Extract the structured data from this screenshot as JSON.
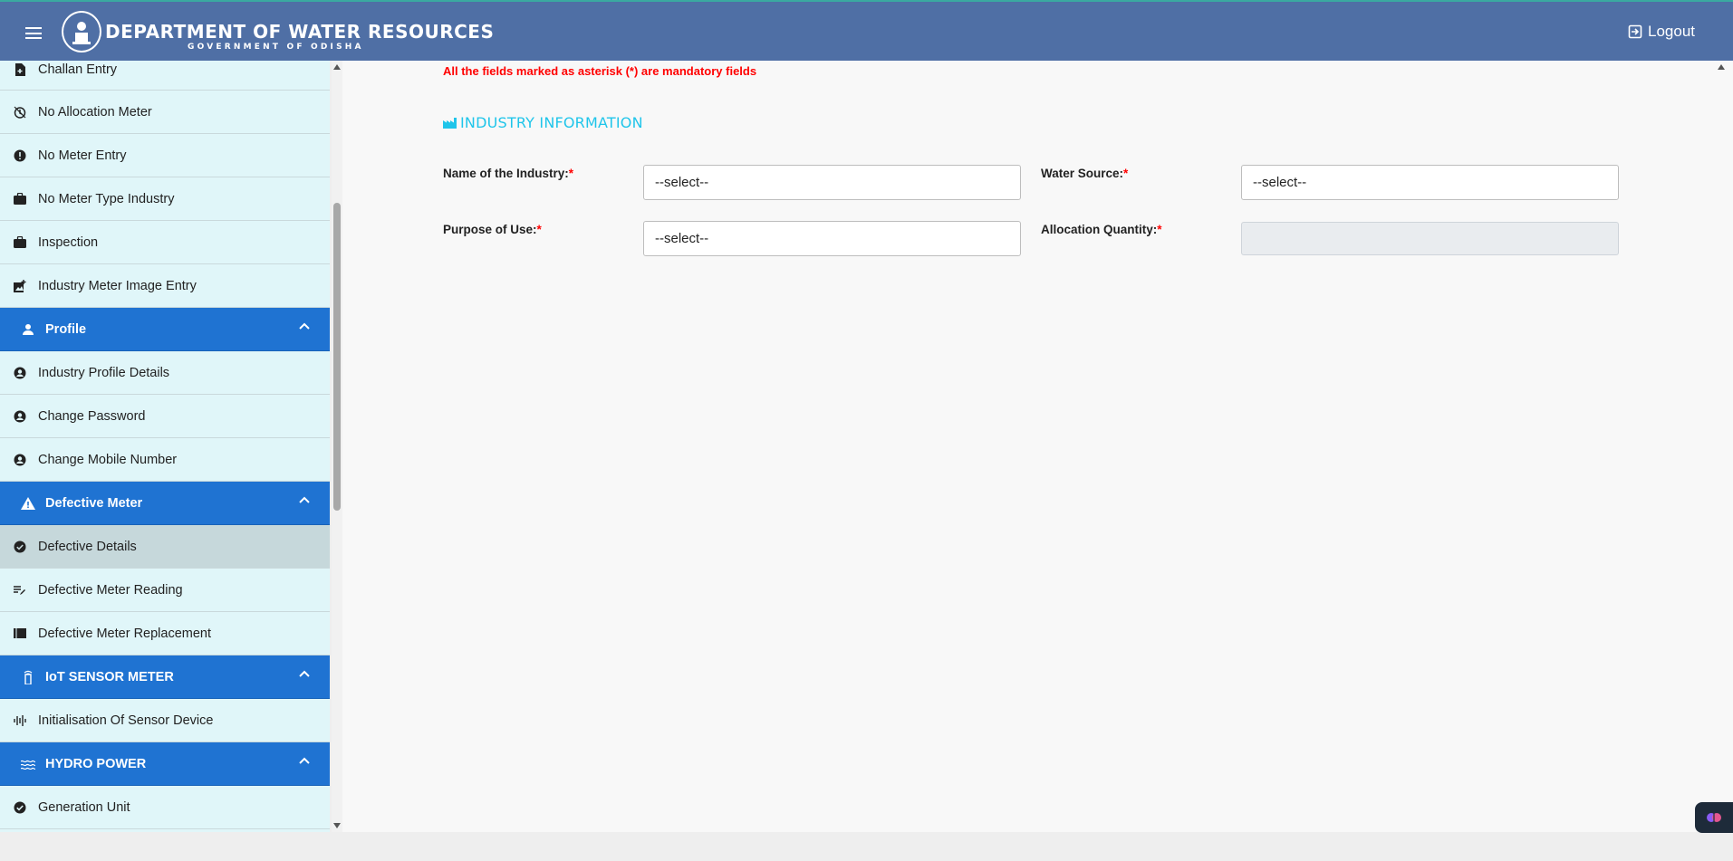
{
  "header": {
    "title": "DEPARTMENT OF WATER RESOURCES",
    "subtitle": "GOVERNMENT OF ODISHA",
    "logout_label": "Logout"
  },
  "sidebar": {
    "items_top": [
      {
        "label": "Challan Entry",
        "icon": "receipt-icon"
      },
      {
        "label": "No Allocation Meter",
        "icon": "timer-off-icon"
      },
      {
        "label": "No Meter Entry",
        "icon": "alert-circle-icon"
      },
      {
        "label": "No Meter Type Industry",
        "icon": "briefcase-icon"
      },
      {
        "label": "Inspection",
        "icon": "briefcase-icon"
      },
      {
        "label": "Industry Meter Image Entry",
        "icon": "add-photo-icon"
      }
    ],
    "group_profile": {
      "label": "Profile",
      "icon": "person-icon"
    },
    "items_profile": [
      {
        "label": "Industry Profile Details",
        "icon": "account-circle-icon"
      },
      {
        "label": "Change Password",
        "icon": "account-circle-icon"
      },
      {
        "label": "Change Mobile Number",
        "icon": "account-circle-icon"
      }
    ],
    "group_defective": {
      "label": "Defective Meter",
      "icon": "warning-icon"
    },
    "items_defective": [
      {
        "label": "Defective Details",
        "icon": "check-circle-icon"
      },
      {
        "label": "Defective Meter Reading",
        "icon": "edit-note-icon"
      },
      {
        "label": "Defective Meter Replacement",
        "icon": "list-icon"
      }
    ],
    "group_iot": {
      "label": "IoT SENSOR METER",
      "icon": "sensor-icon"
    },
    "items_iot": [
      {
        "label": "Initialisation Of Sensor Device",
        "icon": "graphic-eq-icon"
      }
    ],
    "group_hydro": {
      "label": "HYDRO POWER",
      "icon": "waves-icon"
    },
    "items_hydro": [
      {
        "label": "Generation Unit",
        "icon": "check-circle-icon"
      }
    ]
  },
  "form": {
    "mandatory_note": "All the fields marked as asterisk (*) are mandatory fields",
    "section_title": "INDUSTRY INFORMATION",
    "required_mark": "*",
    "industry_name": {
      "label": "Name of the Industry:",
      "value": "--select--"
    },
    "water_source": {
      "label": "Water Source:",
      "value": "--select--"
    },
    "purpose_of_use": {
      "label": "Purpose of Use:",
      "value": "--select--"
    },
    "allocation_quantity": {
      "label": "Allocation Quantity:",
      "value": ""
    }
  },
  "colors": {
    "header_bg": "#4f6fa5",
    "sidebar_bg": "#e0f6f9",
    "group_bg": "#1f73d2",
    "section_title": "#1fc5ea",
    "required": "#ff0000"
  }
}
